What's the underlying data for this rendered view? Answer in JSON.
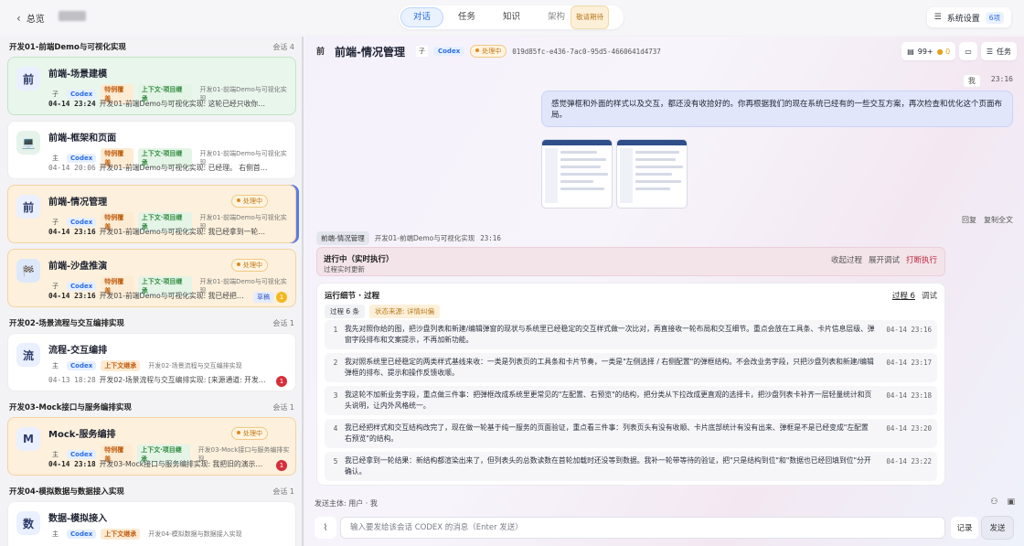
{
  "topbar": {
    "back_label": "总览",
    "tabs": [
      {
        "label": "对话",
        "active": true
      },
      {
        "label": "任务"
      },
      {
        "label": "知识"
      },
      {
        "label": "架构",
        "badge": "敬请期待"
      }
    ],
    "settings_label": "系统设置",
    "settings_count": "6项"
  },
  "sidebar": {
    "groups": [
      {
        "title": "开发01-前端Demo与可视化实现",
        "count": "会话 4"
      },
      {
        "title": "开发02-场景流程与交互编排实现",
        "count": "会话 1"
      },
      {
        "title": "开发03-Mock接口与服务编排实现",
        "count": "会话 1"
      },
      {
        "title": "开发04-模拟数据与数据接入实现",
        "count": "会话 1"
      }
    ],
    "cards": [
      {
        "avatar": "前",
        "title": "前端-场景建模",
        "role": "子",
        "agent": "Codex",
        "special": "特例覆盖",
        "ctx": "上下文·项目继承",
        "path": "开发01-前端Demo与可视化实现",
        "time": "04-14 23:24",
        "preview": "开发01-前端Demo与可视化实现: 这轮已经只收你说的这两…"
      },
      {
        "avatar": "💻",
        "title": "前端-框架和页面",
        "role": "主",
        "agent": "Codex",
        "special": "特例覆盖",
        "ctx": "上下文·项目继承",
        "path": "开发01-前端Demo与可视化实现",
        "time": "04-14 20:06",
        "preview": "开发01-前端Demo与可视化实现: 已经理。 右侧首张沙盘…"
      },
      {
        "avatar": "前",
        "title": "前端-情况管理",
        "status": "处理中",
        "role": "子",
        "agent": "Codex",
        "special": "特例覆盖",
        "ctx": "上下文·项目继承",
        "path": "开发01-前端Demo与可视化实现",
        "time": "04-14 23:16",
        "preview": "开发01-前端Demo与可视化实现: 我已经拿到一轮结果: 新…"
      },
      {
        "avatar": "🏁",
        "title": "前端-沙盘推演",
        "status": "处理中",
        "role": "子",
        "agent": "Codex",
        "special": "特例覆盖",
        "ctx": "上下文·项目继承",
        "path": "开发01-前端Demo与可视化实现",
        "time": "04-14 23:16",
        "preview": "开发01-前端Demo与可视化实现: 我已经把 m…",
        "draft": "草稿",
        "badge": "1"
      },
      {
        "avatar": "流",
        "title": "流程-交互编排",
        "role": "主",
        "agent": "Codex",
        "ctx": "上下文继承",
        "path": "开发02-场景流程与交互编排实现",
        "time": "04-13 18:28",
        "preview": "开发02-场景流程与交互编排实现: [来源通道: 开发02-…",
        "badge": "1"
      },
      {
        "avatar": "M",
        "title": "Mock-服务编排",
        "status": "处理中",
        "role": "主",
        "agent": "Codex",
        "special": "特例覆盖",
        "ctx": "上下文·项目继承",
        "path": "开发03-Mock接口与服务编排实现",
        "time": "04-14 23:18",
        "preview": "开发03-Mock接口与服务编排实现: 我把旧的演示型连…",
        "badge": "1"
      },
      {
        "avatar": "数",
        "title": "数据-模拟接入",
        "role": "主",
        "agent": "Codex",
        "ctx": "上下文继承",
        "path": "开发04-模拟数据与数据接入实现"
      }
    ]
  },
  "chat": {
    "avatar": "前",
    "title": "前端-情况管理",
    "role": "子",
    "agent": "Codex",
    "status": "处理中",
    "session_id": "019d85fc-e436-7ac0-95d5-4660641d4737",
    "header_count": "99+",
    "header_coin": "● 0",
    "header_task": "任务",
    "me_label": "我",
    "me_time": "23:16",
    "user_message": "感觉弹框和外面的样式以及交互，都还没有收拾好的。你再根据我们的现在系统已经有的一些交互方案，再次检查和优化这个页面布局。",
    "msg_reply": "回复",
    "msg_copy": "复制全文",
    "trace_chip": "前端-情况管理",
    "trace_path": "开发01-前端Demo与可视化实现",
    "trace_time": "23:16",
    "live_title": "进行中（实时执行）",
    "live_sub": "过程实时更新",
    "live_collapse": "收起过程",
    "live_expand": "展开调试",
    "live_stop": "打断执行",
    "detail_title": "运行细节 · 过程",
    "detail_tab_process": "过程 6",
    "detail_tab_debug": "调试",
    "detail_count": "过程 6 条",
    "detail_source": "状态来源: 详情纠偏",
    "steps": [
      {
        "n": "1",
        "text": "我先对照你给的图，把沙盘列表和新建/编辑弹窗的现状与系统里已经稳定的交互样式做一次比对，再直接收一轮布局和交互细节。重点会放在工具条、卡片信息层级、弹窗字段排布和文案提示，不再加新功能。",
        "time": "04-14 23:16"
      },
      {
        "n": "2",
        "text": "我对照系统里已经稳定的两类样式基线来收：一类是列表页的工具条和卡片节奏，一类是\"左侧选择 / 右侧配置\"的弹框结构。不会改业务字段，只把沙盘列表和新建/编辑弹框的排布、提示和操作反馈收顺。",
        "time": "04-14 23:17"
      },
      {
        "n": "3",
        "text": "我这轮不加新业务字段，重点做三件事：把弹框改成系统里更常见的\"左配置、右预览\"的结构，把分类从下拉改成更直观的选择卡，把沙盘列表卡补齐一层轻量统计和页头说明，让内外风格统一。",
        "time": "04-14 23:18"
      },
      {
        "n": "4",
        "text": "我已经把样式和交互结构改完了，现在做一轮基于纯一服务的页面验证，重点看三件事：列表页头有没有收顺、卡片底部统计有没有出来、弹框是不是已经变成\"左配置右预览\"的结构。",
        "time": "04-14 23:20"
      },
      {
        "n": "5",
        "text": "我已经拿到一轮结果：新结构都渲染出来了，但列表头的总数读数在首轮加载时还没等到数据。我补一轮带等待的验证，把\"只是结构到位\"和\"数据也已经回填到位\"分开确认。",
        "time": "04-14 23:22"
      }
    ],
    "composer_meta": "发送主体: 用户 · 我",
    "composer_placeholder": "输入要发给该会话 CODEX 的消息（Enter 发送）",
    "log_label": "记录",
    "send_label": "发送"
  }
}
